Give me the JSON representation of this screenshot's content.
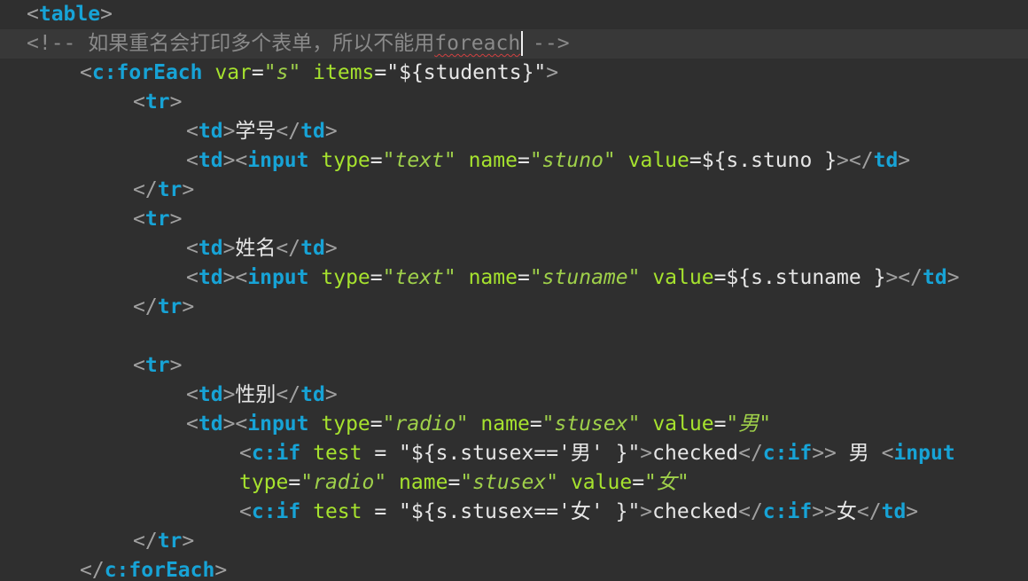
{
  "theme": {
    "background": "#2f2f2f",
    "current_line": "#383838",
    "tag": "#17a3d6",
    "bracket": "#a0a0a0",
    "attribute": "#a6e22e",
    "string": "#9fd04a",
    "text": "#e6e6e6",
    "comment": "#8a8a8a"
  },
  "editor": {
    "current_line_index": 1,
    "lines": [
      {
        "indent": 1,
        "tokens": [
          {
            "t": "<",
            "c": "bracket"
          },
          {
            "t": "table",
            "c": "tag",
            "s": "bold"
          },
          {
            "t": ">",
            "c": "bracket"
          }
        ]
      },
      {
        "indent": 1,
        "tokens": [
          {
            "t": "<!-- 如果重名会打印多个表单，所以不能用",
            "c": "comment"
          },
          {
            "t": "foreach",
            "c": "comment",
            "s": "squiggle",
            "caret_after": true
          },
          {
            "t": " -->",
            "c": "comment"
          }
        ]
      },
      {
        "indent": 3,
        "tokens": [
          {
            "t": "<",
            "c": "bracket"
          },
          {
            "t": "c:forEach",
            "c": "tag",
            "s": "bold"
          },
          {
            "t": " ",
            "c": "text"
          },
          {
            "t": "var",
            "c": "attribute"
          },
          {
            "t": "=",
            "c": "text"
          },
          {
            "t": "\"s\"",
            "c": "string",
            "s": "italic"
          },
          {
            "t": " ",
            "c": "text"
          },
          {
            "t": "items",
            "c": "attribute"
          },
          {
            "t": "=\"${students}\"",
            "c": "text"
          },
          {
            "t": ">",
            "c": "bracket"
          }
        ]
      },
      {
        "indent": 5,
        "tokens": [
          {
            "t": "<",
            "c": "bracket"
          },
          {
            "t": "tr",
            "c": "tag",
            "s": "bold"
          },
          {
            "t": ">",
            "c": "bracket"
          }
        ]
      },
      {
        "indent": 7,
        "tokens": [
          {
            "t": "<",
            "c": "bracket"
          },
          {
            "t": "td",
            "c": "tag",
            "s": "bold"
          },
          {
            "t": ">",
            "c": "bracket"
          },
          {
            "t": "学号",
            "c": "text"
          },
          {
            "t": "</",
            "c": "bracket"
          },
          {
            "t": "td",
            "c": "tag",
            "s": "bold"
          },
          {
            "t": ">",
            "c": "bracket"
          }
        ]
      },
      {
        "indent": 7,
        "tokens": [
          {
            "t": "<",
            "c": "bracket"
          },
          {
            "t": "td",
            "c": "tag",
            "s": "bold"
          },
          {
            "t": "><",
            "c": "bracket"
          },
          {
            "t": "input",
            "c": "tag",
            "s": "bold"
          },
          {
            "t": " ",
            "c": "text"
          },
          {
            "t": "type",
            "c": "attribute"
          },
          {
            "t": "=",
            "c": "text"
          },
          {
            "t": "\"text\"",
            "c": "string",
            "s": "italic"
          },
          {
            "t": " ",
            "c": "text"
          },
          {
            "t": "name",
            "c": "attribute"
          },
          {
            "t": "=",
            "c": "text"
          },
          {
            "t": "\"stuno\"",
            "c": "string",
            "s": "italic"
          },
          {
            "t": " ",
            "c": "text"
          },
          {
            "t": "value",
            "c": "attribute"
          },
          {
            "t": "=${s.stuno }",
            "c": "text"
          },
          {
            "t": "></",
            "c": "bracket"
          },
          {
            "t": "td",
            "c": "tag",
            "s": "bold"
          },
          {
            "t": ">",
            "c": "bracket"
          }
        ]
      },
      {
        "indent": 5,
        "tokens": [
          {
            "t": "</",
            "c": "bracket"
          },
          {
            "t": "tr",
            "c": "tag",
            "s": "bold"
          },
          {
            "t": ">",
            "c": "bracket"
          }
        ]
      },
      {
        "indent": 5,
        "tokens": [
          {
            "t": "<",
            "c": "bracket"
          },
          {
            "t": "tr",
            "c": "tag",
            "s": "bold"
          },
          {
            "t": ">",
            "c": "bracket"
          }
        ]
      },
      {
        "indent": 7,
        "tokens": [
          {
            "t": "<",
            "c": "bracket"
          },
          {
            "t": "td",
            "c": "tag",
            "s": "bold"
          },
          {
            "t": ">",
            "c": "bracket"
          },
          {
            "t": "姓名",
            "c": "text"
          },
          {
            "t": "</",
            "c": "bracket"
          },
          {
            "t": "td",
            "c": "tag",
            "s": "bold"
          },
          {
            "t": ">",
            "c": "bracket"
          }
        ]
      },
      {
        "indent": 7,
        "tokens": [
          {
            "t": "<",
            "c": "bracket"
          },
          {
            "t": "td",
            "c": "tag",
            "s": "bold"
          },
          {
            "t": "><",
            "c": "bracket"
          },
          {
            "t": "input",
            "c": "tag",
            "s": "bold"
          },
          {
            "t": " ",
            "c": "text"
          },
          {
            "t": "type",
            "c": "attribute"
          },
          {
            "t": "=",
            "c": "text"
          },
          {
            "t": "\"text\"",
            "c": "string",
            "s": "italic"
          },
          {
            "t": " ",
            "c": "text"
          },
          {
            "t": "name",
            "c": "attribute"
          },
          {
            "t": "=",
            "c": "text"
          },
          {
            "t": "\"stuname\"",
            "c": "string",
            "s": "italic"
          },
          {
            "t": " ",
            "c": "text"
          },
          {
            "t": "value",
            "c": "attribute"
          },
          {
            "t": "=${s.stuname }",
            "c": "text"
          },
          {
            "t": "></",
            "c": "bracket"
          },
          {
            "t": "td",
            "c": "tag",
            "s": "bold"
          },
          {
            "t": ">",
            "c": "bracket"
          }
        ]
      },
      {
        "indent": 5,
        "tokens": [
          {
            "t": "</",
            "c": "bracket"
          },
          {
            "t": "tr",
            "c": "tag",
            "s": "bold"
          },
          {
            "t": ">",
            "c": "bracket"
          }
        ]
      },
      {
        "indent": 0,
        "tokens": []
      },
      {
        "indent": 5,
        "tokens": [
          {
            "t": "<",
            "c": "bracket"
          },
          {
            "t": "tr",
            "c": "tag",
            "s": "bold"
          },
          {
            "t": ">",
            "c": "bracket"
          }
        ]
      },
      {
        "indent": 7,
        "tokens": [
          {
            "t": "<",
            "c": "bracket"
          },
          {
            "t": "td",
            "c": "tag",
            "s": "bold"
          },
          {
            "t": ">",
            "c": "bracket"
          },
          {
            "t": "性别",
            "c": "text"
          },
          {
            "t": "</",
            "c": "bracket"
          },
          {
            "t": "td",
            "c": "tag",
            "s": "bold"
          },
          {
            "t": ">",
            "c": "bracket"
          }
        ]
      },
      {
        "indent": 7,
        "tokens": [
          {
            "t": "<",
            "c": "bracket"
          },
          {
            "t": "td",
            "c": "tag",
            "s": "bold"
          },
          {
            "t": "><",
            "c": "bracket"
          },
          {
            "t": "input",
            "c": "tag",
            "s": "bold"
          },
          {
            "t": " ",
            "c": "text"
          },
          {
            "t": "type",
            "c": "attribute"
          },
          {
            "t": "=",
            "c": "text"
          },
          {
            "t": "\"radio\"",
            "c": "string",
            "s": "italic"
          },
          {
            "t": " ",
            "c": "text"
          },
          {
            "t": "name",
            "c": "attribute"
          },
          {
            "t": "=",
            "c": "text"
          },
          {
            "t": "\"stusex\"",
            "c": "string",
            "s": "italic"
          },
          {
            "t": " ",
            "c": "text"
          },
          {
            "t": "value",
            "c": "attribute"
          },
          {
            "t": "=",
            "c": "text"
          },
          {
            "t": "\"男\"",
            "c": "string",
            "s": "italic"
          }
        ]
      },
      {
        "indent": 9,
        "tokens": [
          {
            "t": "<",
            "c": "bracket"
          },
          {
            "t": "c:if",
            "c": "tag",
            "s": "bold"
          },
          {
            "t": " ",
            "c": "text"
          },
          {
            "t": "test",
            "c": "attribute"
          },
          {
            "t": " = \"${s.stusex=='男' }\"",
            "c": "text"
          },
          {
            "t": ">",
            "c": "bracket"
          },
          {
            "t": "checked",
            "c": "text"
          },
          {
            "t": "</",
            "c": "bracket"
          },
          {
            "t": "c:if",
            "c": "tag",
            "s": "bold"
          },
          {
            "t": ">>",
            "c": "bracket"
          },
          {
            "t": " 男 ",
            "c": "text"
          },
          {
            "t": "<",
            "c": "bracket"
          },
          {
            "t": "input",
            "c": "tag",
            "s": "bold"
          }
        ]
      },
      {
        "indent": 9,
        "tokens": [
          {
            "t": "type",
            "c": "attribute"
          },
          {
            "t": "=",
            "c": "text"
          },
          {
            "t": "\"radio\"",
            "c": "string",
            "s": "italic"
          },
          {
            "t": " ",
            "c": "text"
          },
          {
            "t": "name",
            "c": "attribute"
          },
          {
            "t": "=",
            "c": "text"
          },
          {
            "t": "\"stusex\"",
            "c": "string",
            "s": "italic"
          },
          {
            "t": " ",
            "c": "text"
          },
          {
            "t": "value",
            "c": "attribute"
          },
          {
            "t": "=",
            "c": "text"
          },
          {
            "t": "\"女\"",
            "c": "string",
            "s": "italic"
          }
        ]
      },
      {
        "indent": 9,
        "tokens": [
          {
            "t": "<",
            "c": "bracket"
          },
          {
            "t": "c:if",
            "c": "tag",
            "s": "bold"
          },
          {
            "t": " ",
            "c": "text"
          },
          {
            "t": "test",
            "c": "attribute"
          },
          {
            "t": " = \"${s.stusex=='女' }\"",
            "c": "text"
          },
          {
            "t": ">",
            "c": "bracket"
          },
          {
            "t": "checked",
            "c": "text"
          },
          {
            "t": "</",
            "c": "bracket"
          },
          {
            "t": "c:if",
            "c": "tag",
            "s": "bold"
          },
          {
            "t": ">>",
            "c": "bracket"
          },
          {
            "t": "女",
            "c": "text"
          },
          {
            "t": "</",
            "c": "bracket"
          },
          {
            "t": "td",
            "c": "tag",
            "s": "bold"
          },
          {
            "t": ">",
            "c": "bracket"
          }
        ]
      },
      {
        "indent": 5,
        "tokens": [
          {
            "t": "</",
            "c": "bracket"
          },
          {
            "t": "tr",
            "c": "tag",
            "s": "bold"
          },
          {
            "t": ">",
            "c": "bracket"
          }
        ]
      },
      {
        "indent": 3,
        "tokens": [
          {
            "t": "</",
            "c": "bracket"
          },
          {
            "t": "c:forEach",
            "c": "tag",
            "s": "bold"
          },
          {
            "t": ">",
            "c": "bracket"
          }
        ]
      }
    ]
  }
}
